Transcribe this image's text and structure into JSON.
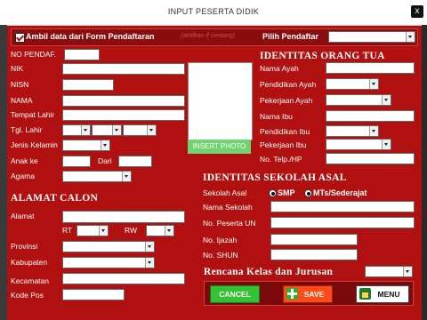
{
  "window": {
    "title": "INPUT PESERTA DIDIK",
    "close_label": "x"
  },
  "header": {
    "checkbox_label": "Ambil data dari Form Pendaftaran",
    "faded_hint": "(aktifkan if centang)",
    "pilih_label": "Pilih Pendaftar"
  },
  "left": {
    "no_pendaf": "NO PENDAF.",
    "nik": "NIK",
    "nisn": "NISN",
    "nama": "NAMA",
    "tempat_lahir": "Tempat Lahir",
    "tgl_lahir": "Tgl. Lahir",
    "jenis_kelamin": "Jenis Kelamin",
    "anak_ke": "Anak ke",
    "dari": "Dari",
    "agama": "Agama"
  },
  "photo": {
    "button": "INSERT PHOTO"
  },
  "alamat_section": {
    "title": "ALAMAT CALON",
    "alamat": "Alamat",
    "rt": "RT",
    "rw": "RW",
    "provinsi": "Provinsi",
    "kabupaten": "Kabupaten",
    "kecamatan": "Kecamatan",
    "kode_pos": "Kode Pos"
  },
  "ortu": {
    "title": "IDENTITAS ORANG TUA",
    "nama_ayah": "Nama Ayah",
    "pendidikan_ayah": "Pendidikan Ayah",
    "pekerjaan_ayah": "Pekerjaan Ayah",
    "nama_ibu": "Nama Ibu",
    "pendidikan_ibu": "Pendidikan Ibu",
    "pekerjaan_ibu": "Pekerjaan Ibu",
    "telp": "No. Telp./HP"
  },
  "sekolah": {
    "title": "IDENTITAS SEKOLAH ASAL",
    "asal": "Sekolah Asal",
    "opt_smp": "SMP",
    "opt_mts": "MTs/Sederajat",
    "nama_sekolah": "Nama Sekolah",
    "no_peserta": "No. Peserta UN",
    "no_ijazah": "No. Ijazah",
    "no_shun": "No. SHUN"
  },
  "rencana": {
    "title": "Rencana Kelas dan Jurusan"
  },
  "buttons": {
    "cancel": "CANCEL",
    "save": "SAVE",
    "menu": "MENU"
  }
}
